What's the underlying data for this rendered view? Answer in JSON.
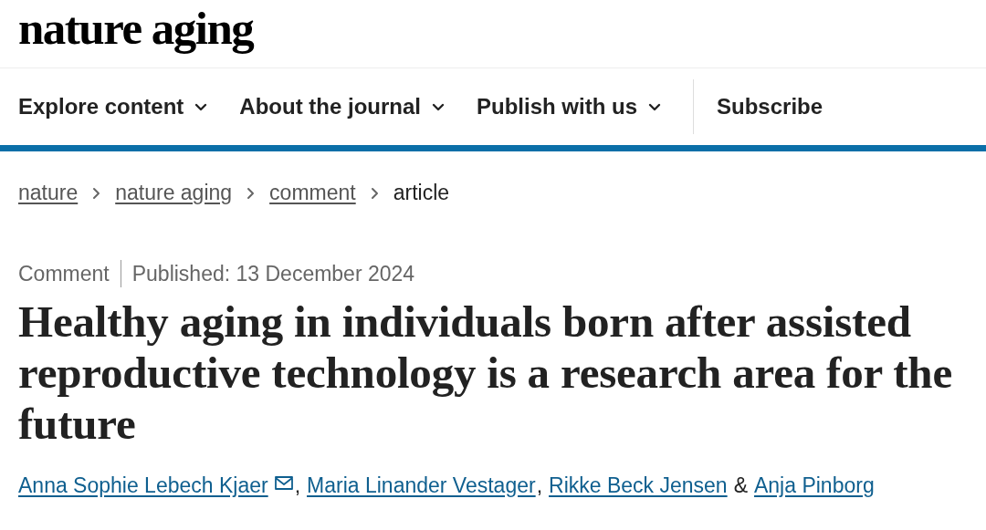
{
  "header": {
    "logo": "nature aging"
  },
  "nav": {
    "items": [
      {
        "label": "Explore content",
        "dropdown": true
      },
      {
        "label": "About the journal",
        "dropdown": true
      },
      {
        "label": "Publish with us",
        "dropdown": true
      },
      {
        "label": "Subscribe",
        "dropdown": false
      }
    ]
  },
  "breadcrumb": [
    {
      "label": "nature",
      "kind": "link"
    },
    {
      "label": "nature aging",
      "kind": "link"
    },
    {
      "label": "comment",
      "kind": "link"
    },
    {
      "label": "article",
      "kind": "current"
    }
  ],
  "article": {
    "type": "Comment",
    "published": "Published: 13 December 2024",
    "title": "Healthy aging in individuals born after assisted reproductive technology is a research area for the future",
    "authors": [
      {
        "name": "Anna Sophie Lebech Kjaer",
        "email": true,
        "separator": ","
      },
      {
        "name": "Maria Linander Vestager",
        "email": false,
        "separator": ","
      },
      {
        "name": "Rikke Beck Jensen",
        "email": false,
        "separator": "&"
      },
      {
        "name": "Anja Pinborg",
        "email": false
      }
    ]
  }
}
